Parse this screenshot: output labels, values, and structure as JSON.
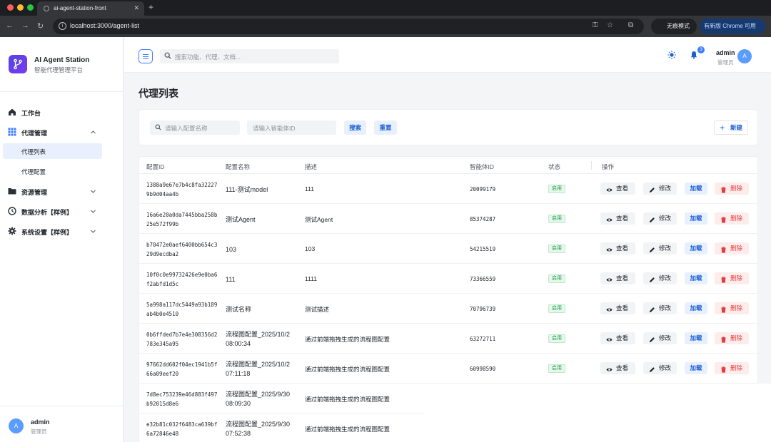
{
  "browser": {
    "tab_title": "ai-agent-station-front",
    "url": "localhost:3000/agent-list",
    "incognito_label": "无痕模式",
    "update_label": "有新版 Chrome 可用"
  },
  "sidebar": {
    "app_title": "AI Agent Station",
    "app_subtitle": "智能代理管理平台",
    "menu": {
      "dashboard": "工作台",
      "agent_mgmt": "代理管理",
      "agent_list": "代理列表",
      "agent_config": "代理配置",
      "resource_mgmt": "资源管理",
      "data_analysis": "数据分析【样例】",
      "system_settings": "系统设置【样例】"
    },
    "user": {
      "avatar": "A",
      "name": "admin",
      "role": "管理员"
    }
  },
  "header": {
    "search_placeholder": "搜索功能、代理、文档...",
    "notification_count": "3",
    "user": {
      "avatar": "A",
      "name": "admin",
      "role": "管理员"
    }
  },
  "main": {
    "title": "代理列表",
    "filters": {
      "config_name_placeholder": "请输入配置名称",
      "agent_id_placeholder": "请输入智能体ID",
      "search_label": "搜索",
      "reset_label": "重置",
      "new_label": "新建"
    },
    "table": {
      "headers": {
        "config_id": "配置ID",
        "config_name": "配置名称",
        "description": "描述",
        "agent_id": "智能体ID",
        "status": "状态",
        "actions": "操作"
      },
      "action_labels": {
        "view": "查看",
        "edit": "修改",
        "load": "加载",
        "delete": "删除"
      },
      "rows": [
        {
          "id": "1388a9e67e7b4c8fa322279b9d04aa4b",
          "name": "111-测试model",
          "desc": "111",
          "agent_id": "20099179",
          "status": "启用"
        },
        {
          "id": "16a6e20a0da7445bba258b25e572f99b",
          "name": "测试Agent",
          "desc": "测试Agent",
          "agent_id": "85374287",
          "status": "启用"
        },
        {
          "id": "b70472e0aef6400bb654c329d9ecdba2",
          "name": "103",
          "desc": "103",
          "agent_id": "54215519",
          "status": "启用"
        },
        {
          "id": "10f0c0e99732426e9e0ba6f2abfd1d5c",
          "name": "111",
          "desc": "1111",
          "agent_id": "73366559",
          "status": "启用"
        },
        {
          "id": "5a998a117dc5449a93b189ab4b0e4510",
          "name": "测试名称",
          "desc": "测试描述",
          "agent_id": "70796739",
          "status": "启用"
        },
        {
          "id": "0b6ffded7b7e4e308356d2783e345a95",
          "name": "流程图配置_2025/10/2 08:00:34",
          "desc": "通过前端拖拽生成的流程图配置",
          "agent_id": "63272711",
          "status": "启用"
        },
        {
          "id": "97662dd602f04ec1941b5f66a09eef20",
          "name": "流程图配置_2025/10/2 07:11:18",
          "desc": "通过前端拖拽生成的流程图配置",
          "agent_id": "60998590",
          "status": "启用"
        },
        {
          "id": "7d8ec753239e46d883f497b92015d8e6",
          "name": "流程图配置_2025/9/30 08:09:30",
          "desc": "通过前端拖拽生成的流程图配置",
          "agent_id": "",
          "status": ""
        },
        {
          "id": "e32b81c032f6483ca639bf6a72846e48",
          "name": "流程图配置_2025/9/30 07:52:38",
          "desc": "通过前端拖拽生成的流程图配置",
          "agent_id": "",
          "status": ""
        }
      ]
    }
  },
  "colors": {
    "accent": "#3d7eff",
    "link": "#1d5fd1",
    "danger": "#e33d3d",
    "success": "#1e9d4b"
  }
}
